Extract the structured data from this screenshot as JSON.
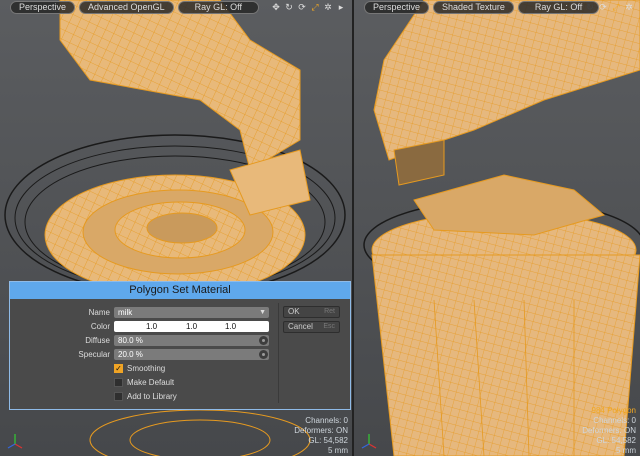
{
  "viewports": {
    "left": {
      "view_label": "Perspective",
      "shading_label": "Advanced OpenGL",
      "raygl_label": "Ray GL: Off"
    },
    "right": {
      "view_label": "Perspective",
      "shading_label": "Shaded Texture",
      "raygl_label": "Ray GL: Off",
      "stats": {
        "polygons": "984 Polygon",
        "channels": "Channels: 0",
        "deformers": "Deformers: ON",
        "gl": "GL: 54,582",
        "scale": "5 mm"
      }
    },
    "left_stats": {
      "channels": "Channels: 0",
      "deformers": "Deformers: ON",
      "gl": "GL: 54,582",
      "scale": "5 mm"
    }
  },
  "icons": [
    "move-icon",
    "rotate-icon",
    "refresh-icon",
    "zoom-icon",
    "gear-icon",
    "play-icon"
  ],
  "colors": {
    "accent": "#f2a821",
    "dialog_title": "#5fa8ec",
    "wire": "#f0a020"
  },
  "dialog": {
    "title": "Polygon Set Material",
    "name_label": "Name",
    "name_value": "milk",
    "color_label": "Color",
    "color_values": [
      "1.0",
      "1.0",
      "1.0"
    ],
    "diffuse_label": "Diffuse",
    "diffuse_value": "80.0 %",
    "specular_label": "Specular",
    "specular_value": "20.0 %",
    "smoothing_label": "Smoothing",
    "smoothing_checked": true,
    "make_default_label": "Make Default",
    "make_default_checked": false,
    "add_library_label": "Add to Library",
    "add_library_checked": false,
    "ok_label": "OK",
    "ok_key": "Ret",
    "cancel_label": "Cancel",
    "cancel_key": "Esc"
  }
}
